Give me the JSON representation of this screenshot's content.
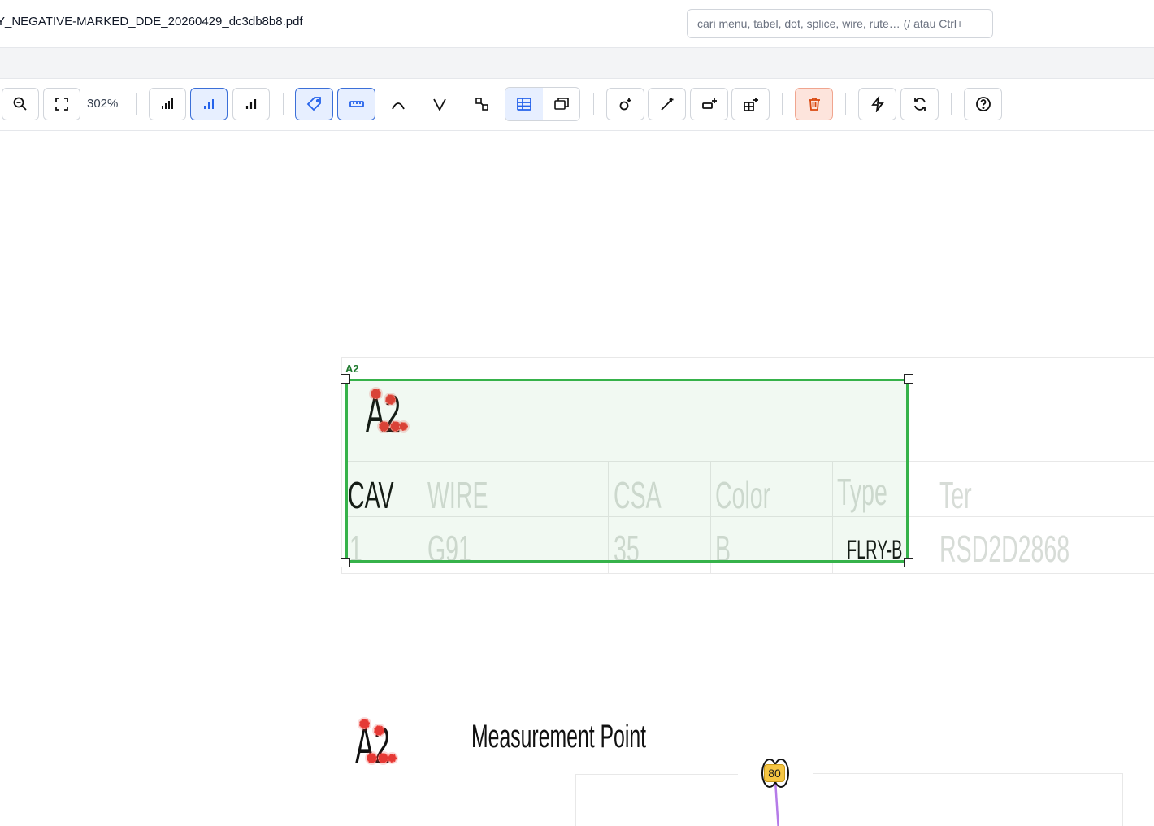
{
  "header": {
    "filename": "Y_NEGATIVE-MARKED_DDE_20260429_dc3db8b8.pdf",
    "search_placeholder": "cari menu, tabel, dot, splice, wire, rute… (/ atau Ctrl+"
  },
  "toolbar": {
    "zoom_level": "302%",
    "icons": [
      "zoom-out-icon",
      "fit-screen-icon",
      "bars-left-icon",
      "bars-center-icon",
      "bars-right-icon",
      "tag-icon",
      "ruler-icon",
      "arc-icon",
      "v-icon",
      "shapes-icon",
      "table-icon",
      "layers-icon",
      "add-node-icon",
      "draw-wire-icon",
      "add-connector-icon",
      "add-table-icon",
      "trash-icon",
      "lightning-icon",
      "refresh-icon",
      "help-icon"
    ]
  },
  "canvas": {
    "selection_tag": "A2",
    "connector_label": "A2",
    "table": {
      "headers": [
        "CAV",
        "WIRE",
        "CSA",
        "Color",
        "Type",
        "Ter"
      ],
      "row": [
        "1",
        "G91",
        "35",
        "B",
        "FLRY-B",
        "RSD2D2868"
      ]
    },
    "measurement_label": "Measurement Point",
    "lower_connector_label": "A2",
    "point_badge": "80",
    "colors": {
      "selection": "#36b24a",
      "dot": "#e53935",
      "badge": "#f5c542",
      "wire": "#b57be8"
    }
  }
}
